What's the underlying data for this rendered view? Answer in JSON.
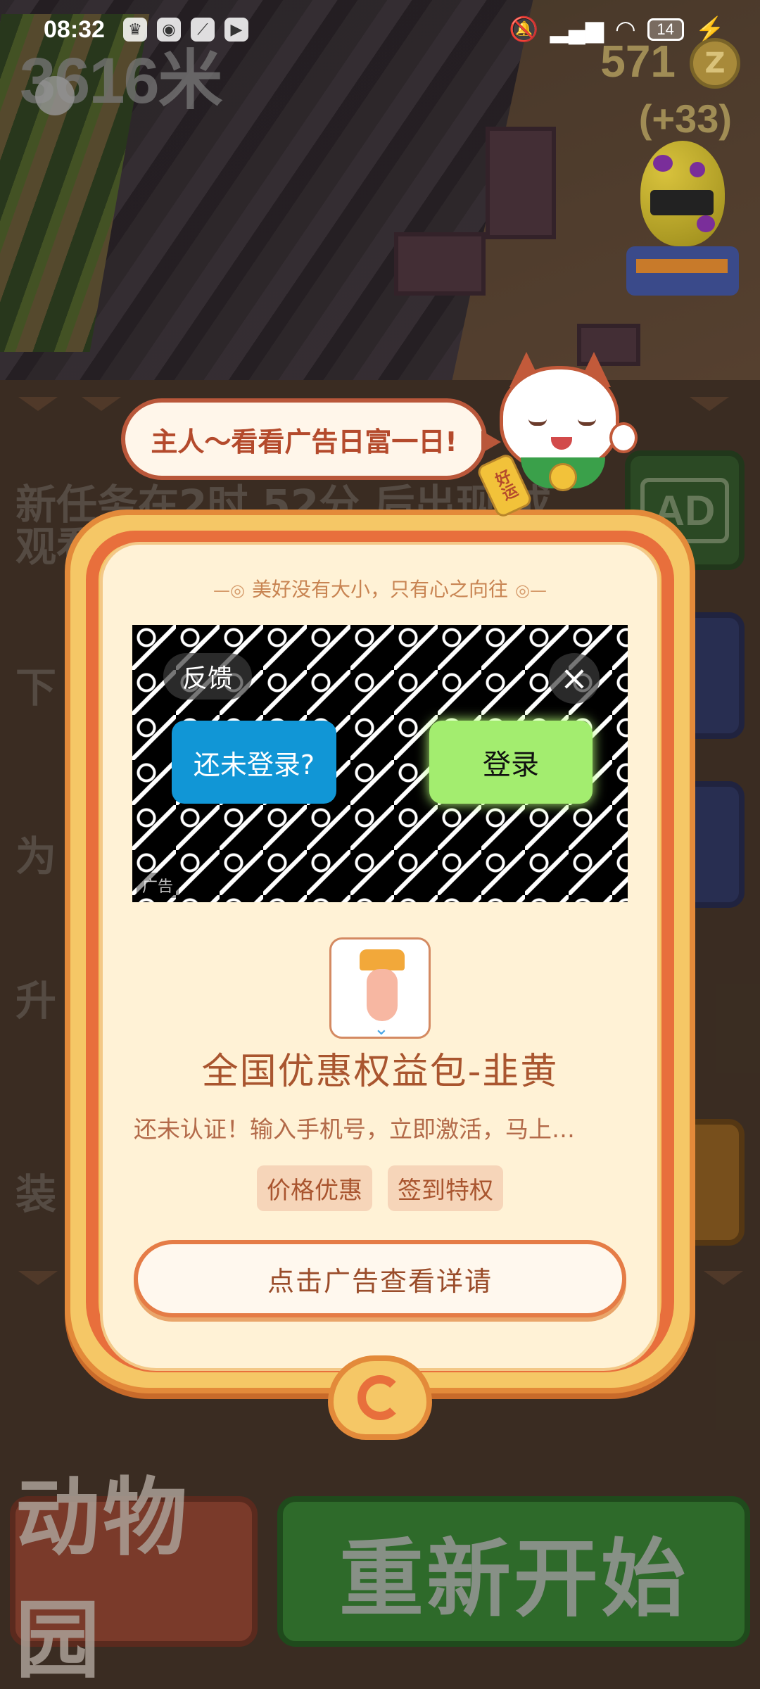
{
  "status_bar": {
    "time": "08:32",
    "battery": "14",
    "icons": [
      "crown-icon",
      "app-icon",
      "link-icon",
      "play-icon",
      "mute-bell-icon",
      "signal-icon",
      "wifi-icon",
      "battery-icon",
      "charging-bolt-icon"
    ]
  },
  "hud": {
    "distance": "3616米",
    "coins": "571",
    "coin_symbol": "Z",
    "bonus": "(+33)"
  },
  "background_menu": {
    "task_line1": "新任务在2时 52分 后出现 或",
    "task_line2": "观看广",
    "row2": "下",
    "row3": "为",
    "row4": "升",
    "row5": "装",
    "ad_button": "AD"
  },
  "bottom_buttons": {
    "zoo": "动物园",
    "restart": "重新开始"
  },
  "mascot": {
    "speech": "主人～看看广告日富一日!",
    "tag": "好运"
  },
  "modal": {
    "motto": "美好没有大小，只有心之向往",
    "ad": {
      "feedback": "反馈",
      "close": "×",
      "not_logged_in": "还未登录?",
      "login": "登录",
      "ad_mark": "广告"
    },
    "product_title": "全国优惠权益包-韭黄",
    "product_desc": "还未认证！输入手机号，立即激活，马上…",
    "tags": [
      "价格优惠",
      "签到特权"
    ],
    "cta": "点击广告查看详请"
  }
}
